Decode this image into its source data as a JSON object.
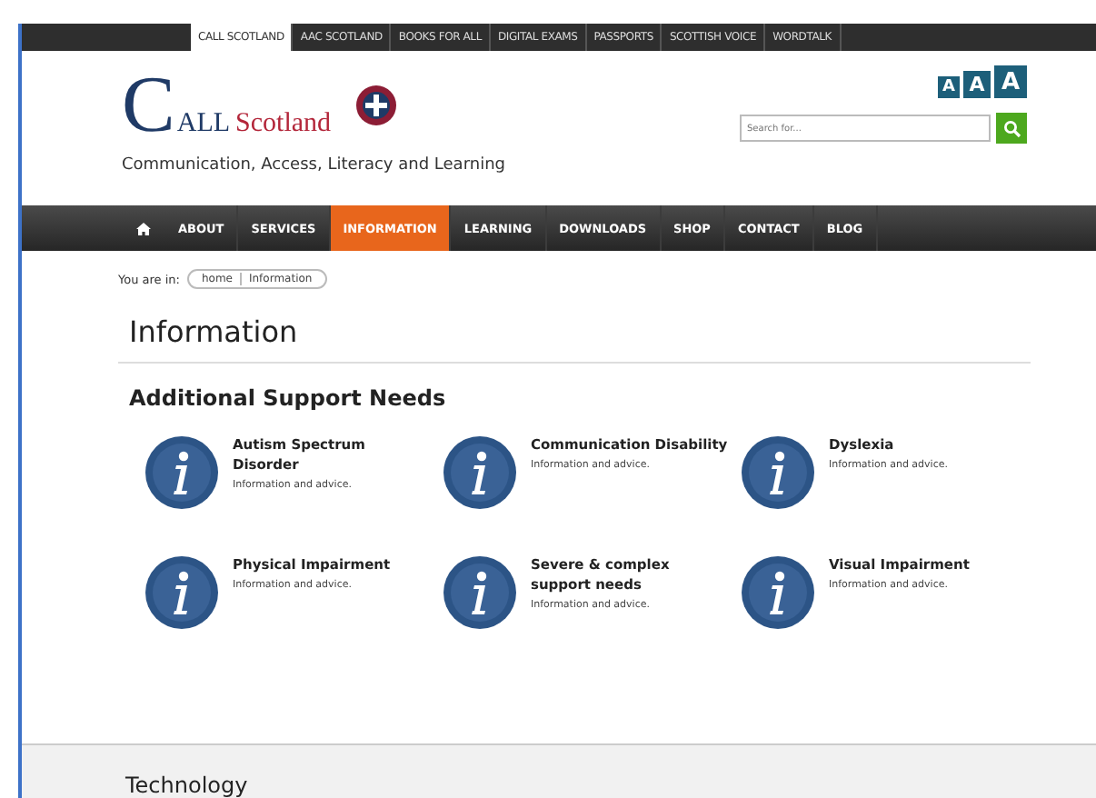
{
  "site_tabs": [
    {
      "label": "CALL SCOTLAND",
      "selected": true
    },
    {
      "label": "AAC SCOTLAND",
      "selected": false
    },
    {
      "label": "BOOKS FOR ALL",
      "selected": false
    },
    {
      "label": "DIGITAL EXAMS",
      "selected": false
    },
    {
      "label": "PASSPORTS",
      "selected": false
    },
    {
      "label": "SCOTTISH VOICE",
      "selected": false
    },
    {
      "label": "WORDTALK",
      "selected": false
    }
  ],
  "logo": {
    "initial": "C",
    "middle": "ALL",
    "name": "Scotland"
  },
  "tagline": "Communication, Access, Literacy and Learning",
  "text_size_buttons": [
    "A",
    "A",
    "A"
  ],
  "search": {
    "placeholder": "Search for..."
  },
  "nav": [
    {
      "label": "ABOUT",
      "selected": false
    },
    {
      "label": "SERVICES",
      "selected": false
    },
    {
      "label": "INFORMATION",
      "selected": true
    },
    {
      "label": "LEARNING",
      "selected": false
    },
    {
      "label": "DOWNLOADS",
      "selected": false
    },
    {
      "label": "SHOP",
      "selected": false
    },
    {
      "label": "CONTACT",
      "selected": false
    },
    {
      "label": "BLOG",
      "selected": false
    }
  ],
  "breadcrumb": {
    "label": "You are in:",
    "items": [
      "home",
      "Information"
    ]
  },
  "page_title": "Information",
  "section_title": "Additional Support Needs",
  "topics": [
    {
      "title": "Autism Spectrum Disorder",
      "description": "Information and advice."
    },
    {
      "title": "Communication Disability",
      "description": "Information and advice."
    },
    {
      "title": "Dyslexia",
      "description": "Information and advice."
    },
    {
      "title": "Physical Impairment",
      "description": "Information and advice."
    },
    {
      "title": "Severe & complex support needs",
      "description": "Information and advice."
    },
    {
      "title": "Visual Impairment",
      "description": "Information and advice."
    }
  ],
  "next_section_title": "Technology"
}
